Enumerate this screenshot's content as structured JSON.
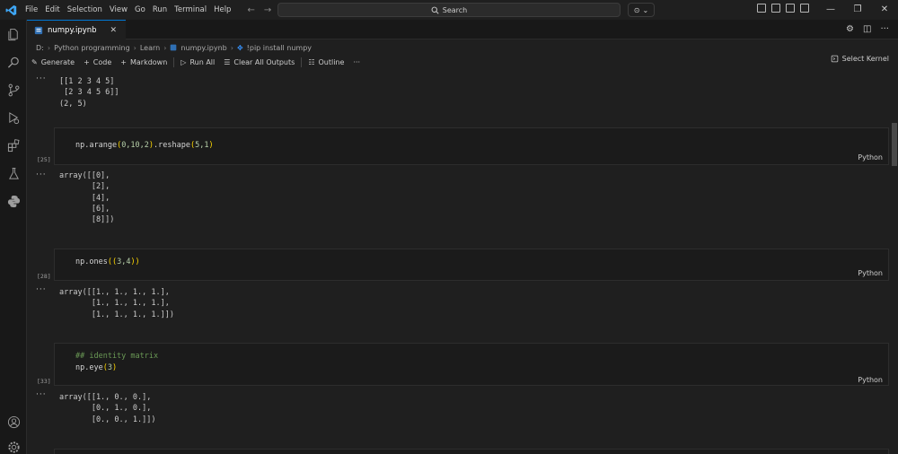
{
  "titlebar": {
    "menu": [
      "File",
      "Edit",
      "Selection",
      "View",
      "Go",
      "Run",
      "Terminal",
      "Help"
    ],
    "search_label": "Search",
    "icons": [
      "vscode-logo-icon",
      "back-arrow-icon",
      "forward-arrow-icon",
      "search-icon",
      "copilot-icon"
    ]
  },
  "tab": {
    "filename": "numpy.ipynb",
    "close_glyph": "✕"
  },
  "breadcrumb": [
    "D:",
    "Python programming",
    "Learn",
    "numpy.ipynb",
    "!pip install numpy"
  ],
  "toolbar": {
    "generate": "Generate",
    "code": "Code",
    "markdown": "Markdown",
    "run_all": "Run All",
    "clear_outputs": "Clear All Outputs",
    "outline": "Outline",
    "more": "···",
    "select_kernel": "Select Kernel"
  },
  "notebook": {
    "output0": {
      "gutter": "···",
      "text": "[[1 2 3 4 5]\n [2 3 4 5 6]]\n(2, 5)"
    },
    "cell1": {
      "exec": "[25]",
      "lang": "Python",
      "code_prefix": "np.arange",
      "args": "0,10,2",
      "method": ".reshape",
      "args2": "5,1"
    },
    "output1": {
      "gutter": "···",
      "text": "array([[0],\n       [2],\n       [4],\n       [6],\n       [8]])"
    },
    "cell2": {
      "exec": "[28]",
      "lang": "Python",
      "code_prefix": "np.ones",
      "args": "3,4"
    },
    "output2": {
      "gutter": "···",
      "text": "array([[1., 1., 1., 1.],\n       [1., 1., 1., 1.],\n       [1., 1., 1., 1.]])"
    },
    "cell3": {
      "exec": "[33]",
      "lang": "Python",
      "comment": "## identity matrix",
      "code_prefix": "np.eye",
      "args": "3"
    },
    "output3": {
      "gutter": "···",
      "text": "array([[1., 0., 0.],\n       [0., 1., 0.],\n       [0., 0., 1.]])"
    }
  },
  "colors": {
    "accent": "#0078d4",
    "background": "#1f1f1f",
    "comment": "#6a9955",
    "paren": "#ffd700"
  }
}
